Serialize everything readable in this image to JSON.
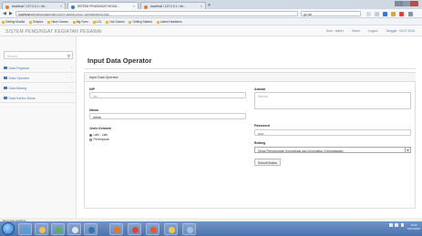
{
  "browser": {
    "tabs": [
      {
        "label": "localhost / 127.0.0.1 / db..."
      },
      {
        "label": "SISTEM PENGINGAT KEGIA..."
      },
      {
        "label": "localhost / 127.0.0.1 / db..."
      }
    ],
    "url_scheme": "localhost",
    "url_path": "/siti/pengingat/index.php?r=admin-input_operator/input-opd",
    "search_value": "go out",
    "bookmarks": [
      "Getting Mozilla",
      "Simplex",
      "Hash Games",
      "Big Farm",
      "LOL",
      "Hot Games",
      "Getting Started",
      "Latest Headlines"
    ]
  },
  "app": {
    "brand": "SISTEM PENGINGAT KEGIATAN PEGAWAI",
    "user_nav": [
      "User : admin",
      "Home",
      "Logout",
      "Tanggal : 18.07.2016"
    ]
  },
  "sidebar": {
    "search_placeholder": "Search",
    "items": [
      {
        "label": "Data Pegawai"
      },
      {
        "label": "Data Operator"
      },
      {
        "label": "Data Bidang"
      },
      {
        "label": "Data Kantor Dinas"
      }
    ]
  },
  "main": {
    "title": "Input Data Operator",
    "panel_heading": "Input Data Operator",
    "fields": {
      "nip_label": "NIP",
      "nip_placeholder": "Nip",
      "nama_label": "Nama",
      "nama_value": "admin",
      "jk_label": "Jenis Kelamin",
      "jk_option_male": "Laki - Laki",
      "jk_option_female": "Perempuan",
      "alamat_label": "Alamat",
      "alamat_placeholder": "Alamat",
      "password_label": "Password",
      "password_value": "•••••",
      "bidang_label": "Bidang",
      "bidang_value": "Dinas Perhubungan Komunikasi dan Informatika | Kepegawaian"
    },
    "submit_label": "Submit Button"
  },
  "statusbar": {
    "text": "Menunggu localhost..."
  },
  "taskbar": {
    "time": "10:45",
    "date": "18/07/2016"
  }
}
